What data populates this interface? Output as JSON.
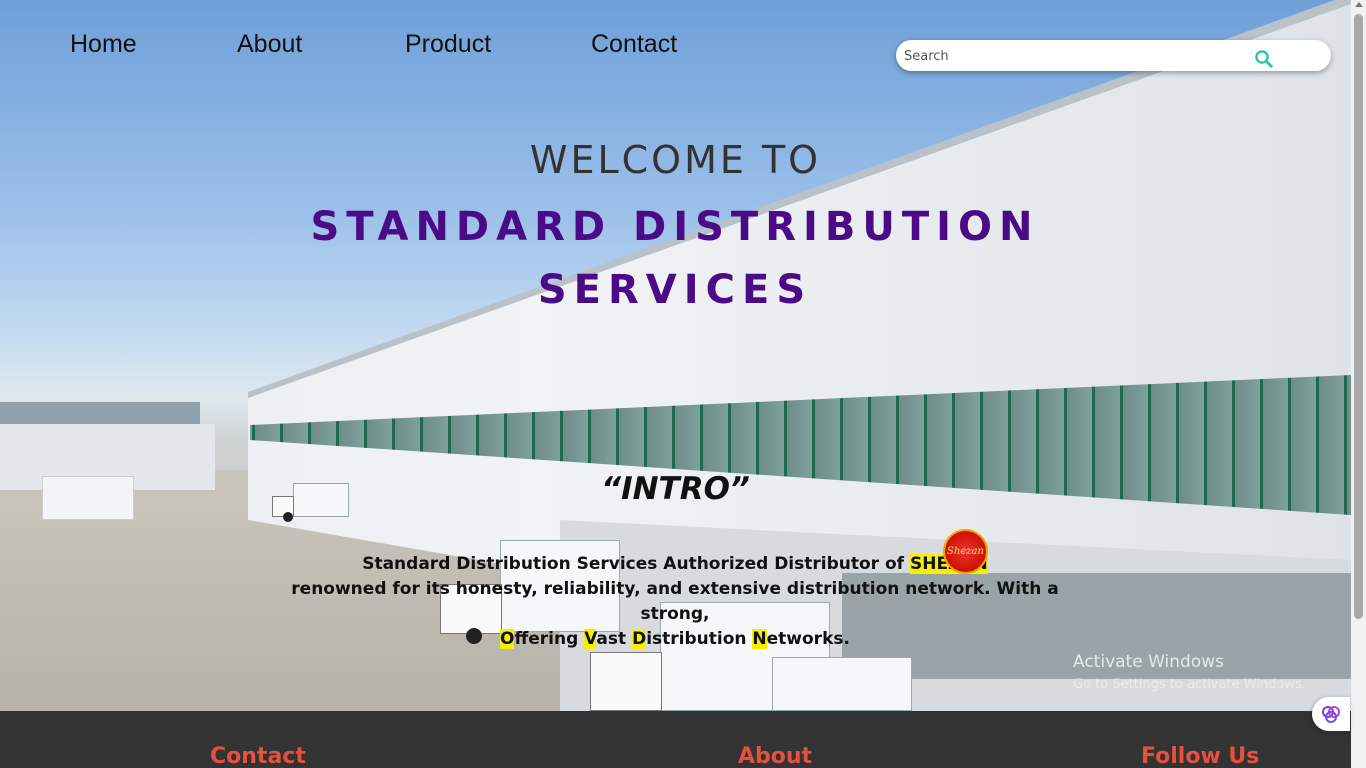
{
  "nav": {
    "items": [
      {
        "label": "Home"
      },
      {
        "label": "About"
      },
      {
        "label": "Product"
      },
      {
        "label": "Contact"
      }
    ]
  },
  "search": {
    "placeholder": "Search"
  },
  "hero": {
    "welcome": "WELCOME TO",
    "company_line1": "STANDARD DISTRIBUTION",
    "company_line2": "SERVICES",
    "intro_heading": "“INTRO”",
    "desc_line1": "Standard Distribution Services Authorized Distributor of",
    "brand": "SHEZAN",
    "desc_line2": "renowned for its honesty, reliability, and extensive distribution network. With a strong,",
    "desc_line3_parts": [
      "O",
      "ffering ",
      "V",
      "ast ",
      "D",
      "istribution ",
      "N",
      "etworks."
    ],
    "logo_text": "Shezan"
  },
  "watermark": {
    "line1": "Activate Windows",
    "line2": "Go to Settings to activate Windows."
  },
  "footer": {
    "contact": "Contact",
    "about": "About",
    "follow": "Follow Us"
  },
  "colors": {
    "accent_purple": "#4b0a86",
    "highlight_yellow": "#f6f000",
    "footer_bg": "#333333",
    "footer_heading": "#e7503d",
    "search_icon": "#2ec4a3"
  }
}
